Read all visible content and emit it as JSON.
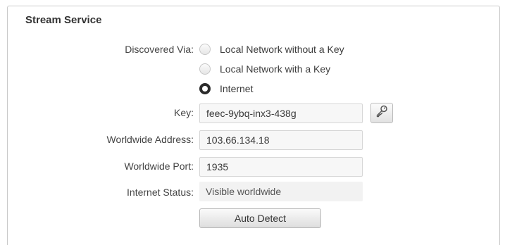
{
  "section": {
    "title": "Stream Service"
  },
  "discovered_via": {
    "label": "Discovered Via:",
    "options": [
      {
        "label": "Local Network without a Key",
        "selected": false
      },
      {
        "label": "Local Network with a Key",
        "selected": false
      },
      {
        "label": "Internet",
        "selected": true
      }
    ]
  },
  "key": {
    "label": "Key:",
    "value": "feec-9ybq-inx3-438g",
    "button_icon": "key-icon"
  },
  "worldwide_address": {
    "label": "Worldwide Address:",
    "value": "103.66.134.18"
  },
  "worldwide_port": {
    "label": "Worldwide Port:",
    "value": "1935"
  },
  "internet_status": {
    "label": "Internet Status:",
    "value": "Visible worldwide"
  },
  "auto_detect": {
    "label": "Auto Detect"
  }
}
